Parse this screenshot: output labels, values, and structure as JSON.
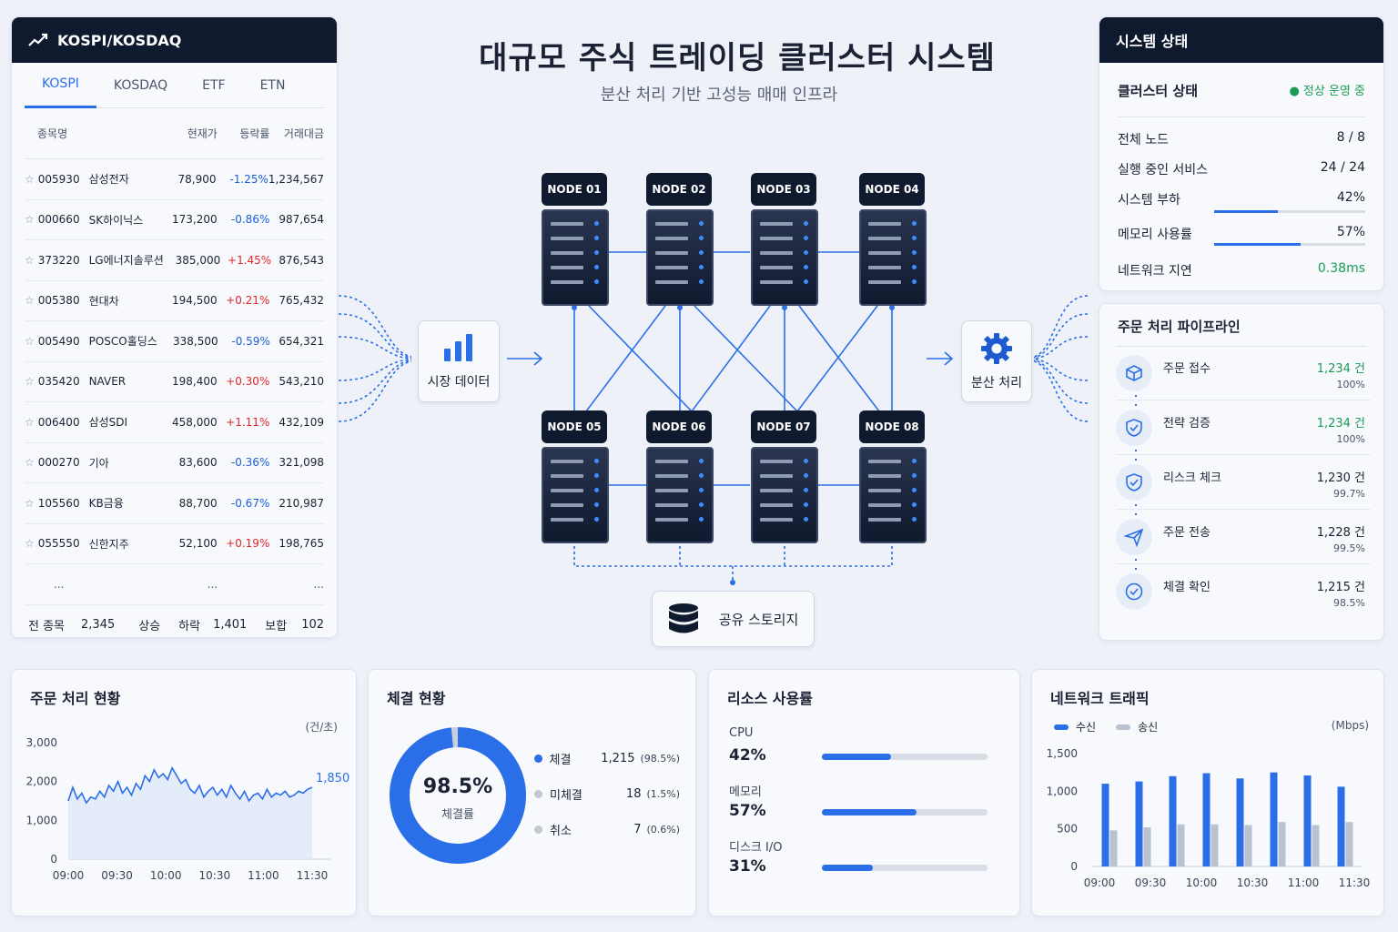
{
  "market": {
    "title": "KOSPI/KOSDAQ",
    "tabs": [
      "KOSPI",
      "KOSDAQ",
      "ETF",
      "ETN"
    ],
    "columns": [
      "종목명",
      "현재가",
      "등락률",
      "거래대금"
    ],
    "rows": [
      {
        "code": "005930",
        "name": "삼성전자",
        "price": "78,900",
        "change": "-1.25%",
        "volume": "1,234,567",
        "dir": "down"
      },
      {
        "code": "000660",
        "name": "SK하이닉스",
        "price": "173,200",
        "change": "-0.86%",
        "volume": "987,654",
        "dir": "down"
      },
      {
        "code": "373220",
        "name": "LG에너지솔루션",
        "price": "385,000",
        "change": "+1.45%",
        "volume": "876,543",
        "dir": "up"
      },
      {
        "code": "005380",
        "name": "현대차",
        "price": "194,500",
        "change": "+0.21%",
        "volume": "765,432",
        "dir": "up"
      },
      {
        "code": "005490",
        "name": "POSCO홀딩스",
        "price": "338,500",
        "change": "-0.59%",
        "volume": "654,321",
        "dir": "down"
      },
      {
        "code": "035420",
        "name": "NAVER",
        "price": "198,400",
        "change": "+0.30%",
        "volume": "543,210",
        "dir": "up"
      },
      {
        "code": "006400",
        "name": "삼성SDI",
        "price": "458,000",
        "change": "+1.11%",
        "volume": "432,109",
        "dir": "up"
      },
      {
        "code": "000270",
        "name": "기아",
        "price": "83,600",
        "change": "-0.36%",
        "volume": "321,098",
        "dir": "down"
      },
      {
        "code": "105560",
        "name": "KB금융",
        "price": "88,700",
        "change": "-0.67%",
        "volume": "210,987",
        "dir": "down"
      },
      {
        "code": "055550",
        "name": "신한지주",
        "price": "52,100",
        "change": "+0.19%",
        "volume": "198,765",
        "dir": "up"
      }
    ],
    "ellipsis": "...",
    "footer": {
      "all_label": "전 종목",
      "all_value": "2,345",
      "up_label": "상승",
      "down_label": "하락",
      "down_value": "1,401",
      "flat_label": "보합",
      "flat_value": "102"
    }
  },
  "header": {
    "title": "대규모 주식 트레이딩 클러스터 시스템",
    "subtitle": "분산 처리 기반 고성능 매매 인프라"
  },
  "cluster": {
    "nodes": [
      "NODE 01",
      "NODE 02",
      "NODE 03",
      "NODE 04",
      "NODE 05",
      "NODE 06",
      "NODE 07",
      "NODE 08"
    ],
    "input_label": "시장 데이터",
    "output_label": "분산 처리",
    "storage_label": "공유 스토리지"
  },
  "system": {
    "title": "시스템 상태",
    "cluster_label": "클러스터 상태",
    "cluster_status": "정상 운영 중",
    "items": [
      {
        "label": "전체 노드",
        "value": "8 / 8"
      },
      {
        "label": "실행 중인 서비스",
        "value": "24 / 24"
      },
      {
        "label": "시스템 부하",
        "value": "42%",
        "level": 0.42
      },
      {
        "label": "메모리 사용률",
        "value": "57%",
        "level": 0.57
      },
      {
        "label": "네트워크 지연",
        "value": "0.38ms"
      }
    ]
  },
  "pipeline": {
    "title": "주문 처리 파이프라인",
    "steps": [
      {
        "label": "주문 접수",
        "count": "1,234 건",
        "pct": "100%",
        "icon": "box-icon"
      },
      {
        "label": "전략 검증",
        "count": "1,234 건",
        "pct": "100%",
        "icon": "shield-check-icon"
      },
      {
        "label": "리스크 체크",
        "count": "1,230 건",
        "pct": "99.7%",
        "icon": "shield-check-icon"
      },
      {
        "label": "주문 전송",
        "count": "1,228 건",
        "pct": "99.5%",
        "icon": "send-icon"
      },
      {
        "label": "체결 확인",
        "count": "1,215 건",
        "pct": "98.5%",
        "icon": "check-circle-icon"
      }
    ]
  },
  "orders": {
    "title": "주문 처리 현황",
    "unit": "(건/초)",
    "last_value": "1,850"
  },
  "fills": {
    "title": "체결 현황",
    "center_value": "98.5%",
    "center_label": "체결률",
    "legend": [
      {
        "label": "체결",
        "count": "1,215",
        "pct": "(98.5%)",
        "color": "#2a6fe8"
      },
      {
        "label": "미체결",
        "count": "18",
        "pct": "(1.5%)",
        "color": "#c2c9d4"
      },
      {
        "label": "취소",
        "count": "7",
        "pct": "(0.6%)",
        "color": "#c2c9d4"
      }
    ]
  },
  "resources": {
    "title": "리소스 사용률",
    "items": [
      {
        "label": "CPU",
        "value": "42%",
        "level": 0.42
      },
      {
        "label": "메모리",
        "value": "57%",
        "level": 0.57
      },
      {
        "label": "디스크 I/O",
        "value": "31%",
        "level": 0.31
      }
    ]
  },
  "traffic": {
    "title": "네트워크 트래픽",
    "unit": "(Mbps)",
    "legend": [
      {
        "label": "수신",
        "color": "#2a6fe8"
      },
      {
        "label": "송신",
        "color": "#b9c2d0"
      }
    ]
  },
  "chart_data": [
    {
      "type": "area",
      "ylim": [
        0,
        3000
      ],
      "yticks": [
        "3,000",
        "2,000",
        "1,000",
        "0"
      ],
      "xticks": [
        "09:00",
        "09:30",
        "10:00",
        "10:30",
        "11:00",
        "11:30"
      ],
      "values": [
        1500,
        1850,
        1550,
        1700,
        1450,
        1600,
        1550,
        1750,
        1600,
        1900,
        1750,
        2000,
        1700,
        1850,
        1650,
        1950,
        1800,
        2150,
        2000,
        2300,
        2100,
        2200,
        2050,
        2350,
        2150,
        1950,
        2050,
        1800,
        1700,
        1900,
        1600,
        1750,
        1850,
        1650,
        1800,
        1600,
        1900,
        1700,
        1550,
        1750,
        1500,
        1650,
        1700,
        1550,
        1800,
        1600,
        1700,
        1650,
        1750,
        1600,
        1650,
        1750,
        1700,
        1800,
        1850
      ],
      "last_label": "1,850"
    },
    {
      "type": "pie",
      "slices": [
        {
          "label": "체결",
          "value": 98.5
        },
        {
          "label": "미체결",
          "value": 1.5
        }
      ]
    },
    {
      "type": "bar",
      "ylim": [
        0,
        1500
      ],
      "yticks": [
        "1,500",
        "1,000",
        "500",
        "0"
      ],
      "xticks": [
        "09:00",
        "09:30",
        "10:00",
        "10:30",
        "11:00",
        "11:30"
      ],
      "series": [
        {
          "name": "수신",
          "values": [
            1100,
            1130,
            1200,
            1240,
            1170,
            1250,
            1210,
            1060
          ]
        },
        {
          "name": "송신",
          "values": [
            480,
            520,
            560,
            560,
            550,
            590,
            550,
            590
          ]
        }
      ]
    }
  ]
}
